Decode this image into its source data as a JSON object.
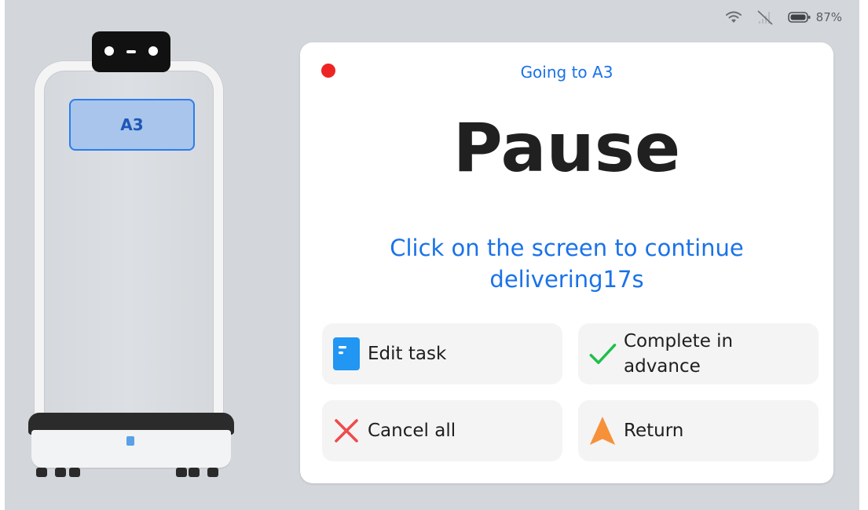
{
  "status_bar": {
    "wifi_icon": "wifi-icon",
    "signal_icon": "no-signal-icon",
    "battery_icon": "battery-icon",
    "battery_percent": "87%"
  },
  "robot": {
    "tray_label": "A3"
  },
  "dialog": {
    "recording_indicator_color": "#ee2424",
    "subtitle": "Going to A3",
    "title": "Pause",
    "instruction_line1": "Click on the screen to continue",
    "instruction_line2": "delivering17s",
    "actions": [
      {
        "label": "Edit task",
        "icon": "edit-task-icon"
      },
      {
        "label_line1": "Complete in",
        "label_line2": "advance",
        "icon": "checkmark-icon"
      },
      {
        "label": "Cancel all",
        "icon": "close-icon"
      },
      {
        "label": "Return",
        "icon": "navigation-arrow-icon"
      }
    ]
  },
  "colors": {
    "accent_blue": "#1a72e8",
    "background": "#d3d7dc",
    "check_green": "#1fbf4a",
    "cancel_red": "#ef4b4b",
    "return_orange": "#f6913a",
    "edit_blue": "#2196f3"
  }
}
